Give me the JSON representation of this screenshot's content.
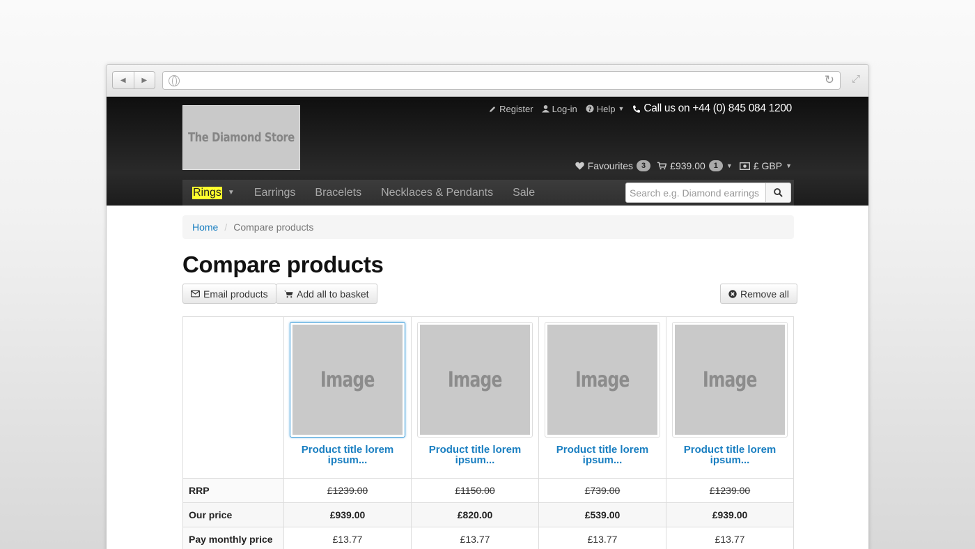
{
  "header": {
    "logo_text": "The Diamond Store",
    "links": {
      "register": "Register",
      "login": "Log-in",
      "help": "Help",
      "phone": "Call us on +44 (0) 845 084 1200"
    },
    "userbar": {
      "favourites_label": "Favourites",
      "favourites_count": "3",
      "basket_total": "£939.00",
      "basket_count": "1",
      "currency": "£ GBP"
    }
  },
  "nav": {
    "items": [
      "Rings",
      "Earrings",
      "Bracelets",
      "Necklaces & Pendants",
      "Sale"
    ],
    "search_placeholder": "Search e.g. Diamond earrings"
  },
  "breadcrumb": {
    "home": "Home",
    "current": "Compare products"
  },
  "page": {
    "title": "Compare products",
    "email_button": "Email products",
    "basket_button": "Add all to basket",
    "remove_button": "Remove all"
  },
  "products": [
    {
      "image": "Image",
      "title": "Product title lorem ipsum...",
      "rrp": "£1239.00",
      "price": "£939.00",
      "monthly": "£13.77"
    },
    {
      "image": "Image",
      "title": "Product title lorem ipsum...",
      "rrp": "£1150.00",
      "price": "£820.00",
      "monthly": "£13.77"
    },
    {
      "image": "Image",
      "title": "Product title lorem ipsum...",
      "rrp": "£739.00",
      "price": "£539.00",
      "monthly": "£13.77"
    },
    {
      "image": "Image",
      "title": "Product title lorem ipsum...",
      "rrp": "£1239.00",
      "price": "£939.00",
      "monthly": "£13.77"
    }
  ],
  "row_labels": {
    "rrp": "RRP",
    "price": "Our price",
    "monthly": "Pay monthly price"
  },
  "colors": {
    "link": "#1a7fc1",
    "highlight": "#ffff2d",
    "header_bg": "#1c1c1c"
  }
}
